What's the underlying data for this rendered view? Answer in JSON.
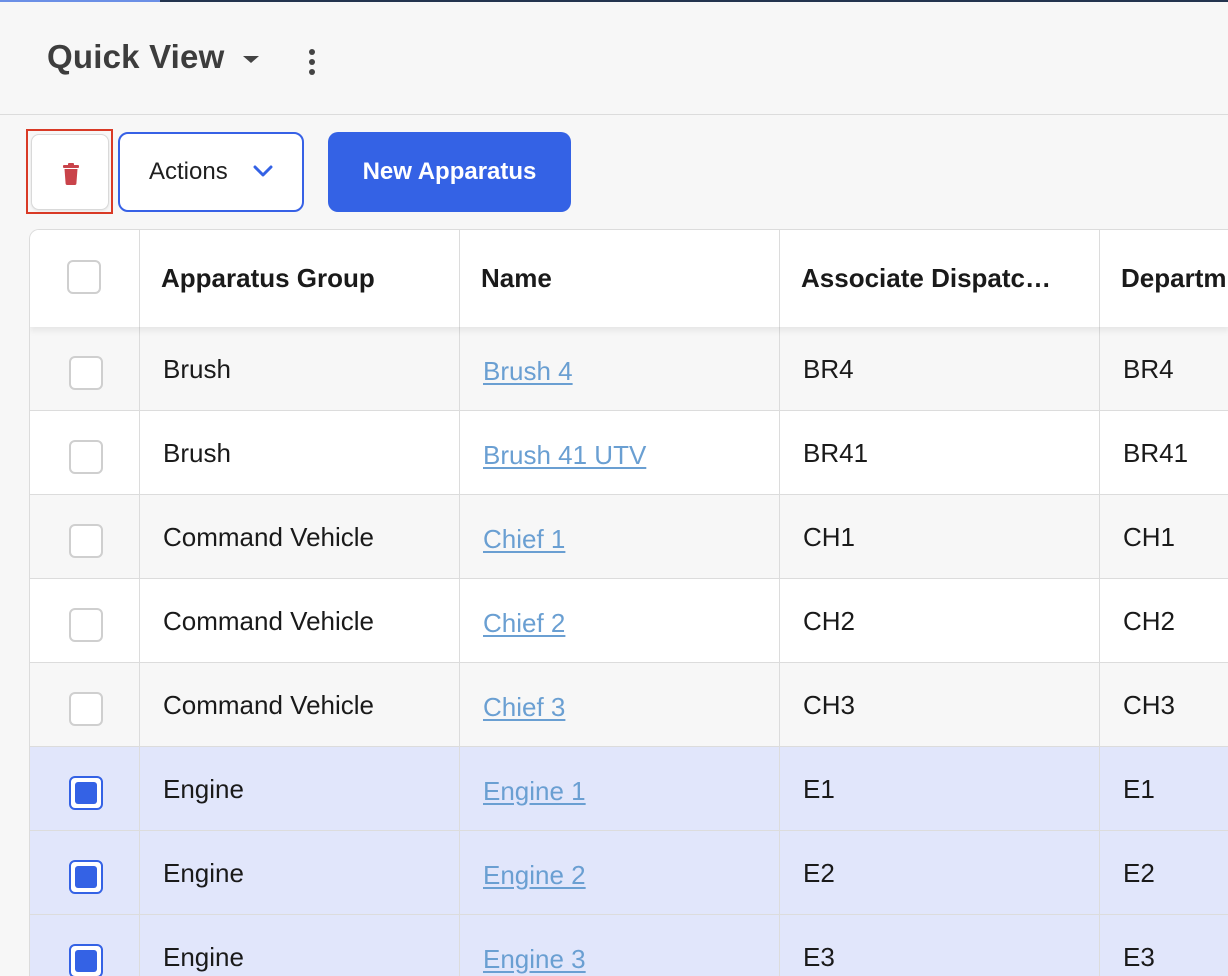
{
  "header": {
    "title": "Quick View"
  },
  "toolbar": {
    "actions_label": "Actions",
    "new_label": "New Apparatus"
  },
  "colors": {
    "primary": "#3462e5",
    "delete_icon": "#c9434a",
    "link": "#6a9fd2",
    "selected_row": "#e1e6fb",
    "highlight": "#d93a26"
  },
  "table": {
    "columns": [
      "Apparatus Group",
      "Name",
      "Associate Dispatc…",
      "Departm"
    ],
    "rows": [
      {
        "group": "Brush",
        "name": "Brush 4",
        "dispatch": "BR4",
        "dept": "BR4",
        "selected": false
      },
      {
        "group": "Brush",
        "name": "Brush 41 UTV",
        "dispatch": "BR41",
        "dept": "BR41",
        "selected": false
      },
      {
        "group": "Command Vehicle",
        "name": "Chief 1",
        "dispatch": "CH1",
        "dept": "CH1",
        "selected": false
      },
      {
        "group": "Command Vehicle",
        "name": "Chief 2",
        "dispatch": "CH2",
        "dept": "CH2",
        "selected": false
      },
      {
        "group": "Command Vehicle",
        "name": "Chief 3",
        "dispatch": "CH3",
        "dept": "CH3",
        "selected": false
      },
      {
        "group": "Engine",
        "name": "Engine 1",
        "dispatch": "E1",
        "dept": "E1",
        "selected": true
      },
      {
        "group": "Engine",
        "name": "Engine 2",
        "dispatch": "E2",
        "dept": "E2",
        "selected": true
      },
      {
        "group": "Engine",
        "name": "Engine 3",
        "dispatch": "E3",
        "dept": "E3",
        "selected": true
      }
    ]
  }
}
